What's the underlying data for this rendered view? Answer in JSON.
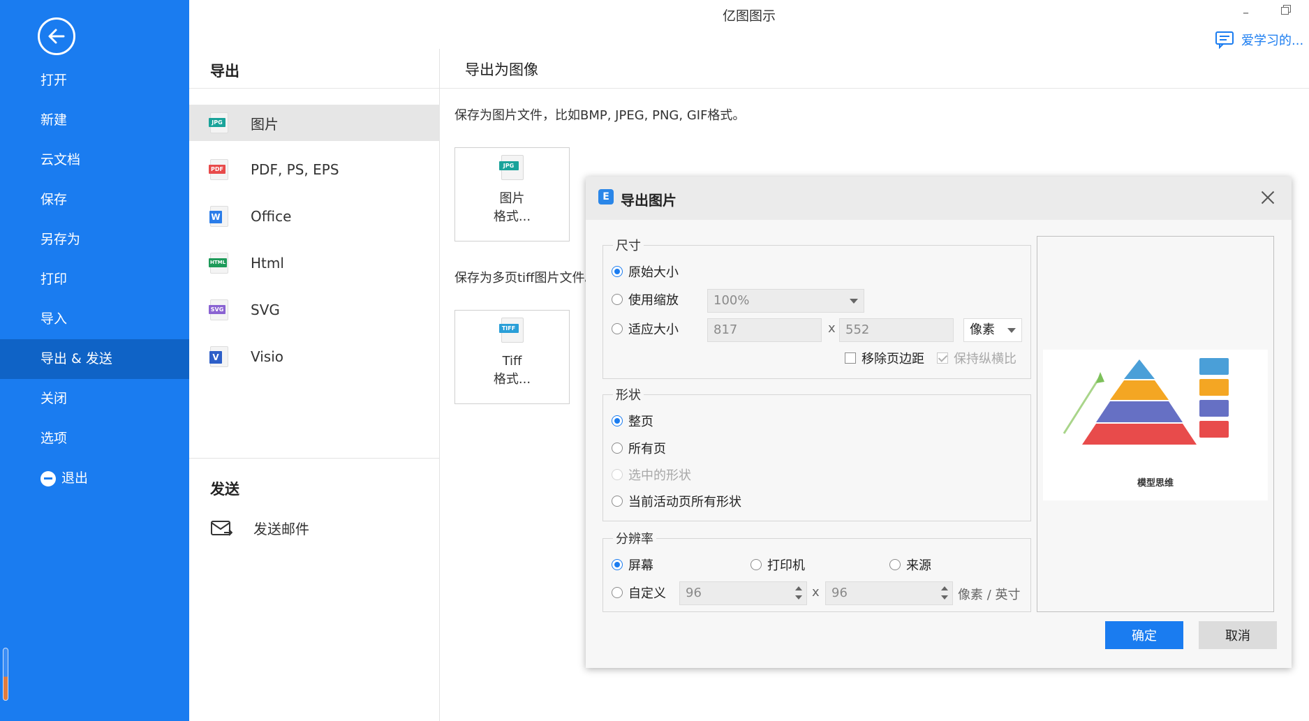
{
  "window": {
    "title": "亿图图示",
    "minimize": "–",
    "user_name": "爱学习的..."
  },
  "sidebar": {
    "items": [
      {
        "label": "打开"
      },
      {
        "label": "新建"
      },
      {
        "label": "云文档"
      },
      {
        "label": "保存"
      },
      {
        "label": "另存为"
      },
      {
        "label": "打印"
      },
      {
        "label": "导入"
      },
      {
        "label": "导出 & 发送"
      },
      {
        "label": "关闭"
      },
      {
        "label": "选项"
      },
      {
        "label": "退出"
      }
    ],
    "active_index": 7
  },
  "export_panel": {
    "title": "导出",
    "items": [
      {
        "label": "图片",
        "icon": "jpg-file-icon",
        "badge": "JPG",
        "color": "#1aa39a"
      },
      {
        "label": "PDF, PS, EPS",
        "icon": "pdf-file-icon",
        "badge": "PDF",
        "color": "#e84b4b"
      },
      {
        "label": "Office",
        "icon": "word-file-icon",
        "badge": "W",
        "color": "#2b7de9"
      },
      {
        "label": "Html",
        "icon": "html-file-icon",
        "badge": "HTML",
        "color": "#1e9a5a"
      },
      {
        "label": "SVG",
        "icon": "svg-file-icon",
        "badge": "SVG",
        "color": "#8a63d2"
      },
      {
        "label": "Visio",
        "icon": "visio-file-icon",
        "badge": "V",
        "color": "#2d5fc8"
      }
    ],
    "send_title": "发送",
    "send_mail": "发送邮件"
  },
  "content": {
    "title": "导出为图像",
    "desc_image": "保存为图片文件，比如BMP, JPEG, PNG, GIF格式。",
    "image_btn": {
      "badge": "JPG",
      "line1": "图片",
      "line2": "格式..."
    },
    "desc_tiff": "保存为多页tiff图片文件。",
    "tiff_btn": {
      "badge": "TIFF",
      "line1": "Tiff",
      "line2": "格式..."
    }
  },
  "dialog": {
    "logo": "E",
    "title": "导出图片",
    "size": {
      "label": "尺寸",
      "original": "原始大小",
      "use_zoom": "使用缩放",
      "zoom_value": "100%",
      "fit": "适应大小",
      "width": "817",
      "x": "x",
      "height": "552",
      "unit": "像素",
      "remove_margin": "移除页边距",
      "keep_ratio": "保持纵横比"
    },
    "shape": {
      "label": "形状",
      "whole_page": "整页",
      "all_pages": "所有页",
      "selected": "选中的形状",
      "active_all": "当前活动页所有形状"
    },
    "resolution": {
      "label": "分辨率",
      "screen": "屏幕",
      "printer": "打印机",
      "source": "来源",
      "custom": "自定义",
      "dpi_x": "96",
      "x": "x",
      "dpi_y": "96",
      "unit": "像素 / 英寸"
    },
    "preview_caption": "模型思维",
    "ok": "确定",
    "cancel": "取消"
  }
}
